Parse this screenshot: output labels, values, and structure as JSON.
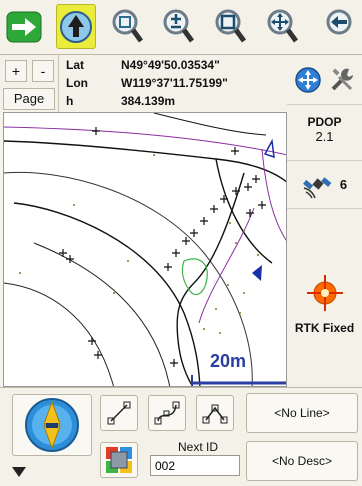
{
  "toolbar": {
    "buttons": [
      {
        "name": "forward-arrow-icon"
      },
      {
        "name": "north-up-icon"
      },
      {
        "name": "zoom-extents-icon"
      },
      {
        "name": "zoom-in-out-icon"
      },
      {
        "name": "zoom-window-icon"
      },
      {
        "name": "pan-icon"
      },
      {
        "name": "back-arrow-icon"
      }
    ]
  },
  "coords": {
    "plus": "+",
    "minus": "-",
    "page": "Page",
    "lat_label": "Lat",
    "lon_label": "Lon",
    "h_label": "h",
    "lat": "N49°49'50.03534\"",
    "lon": "W119°37'11.75199\"",
    "h": "384.139m"
  },
  "status": {
    "pdop_label": "PDOP",
    "pdop_value": "2.1",
    "satellites": "6",
    "rtk": "RTK Fixed"
  },
  "map": {
    "scale": "20m"
  },
  "bottom": {
    "no_line": "<No Line>",
    "no_desc": "<No Desc>",
    "next_id_label": "Next ID",
    "next_id_value": "002"
  },
  "colors": {
    "accent_yellow": "#e9ec3a",
    "toolbar_bg": "#f3f1e8",
    "scale_blue": "#2a3ea3",
    "rtk_orange": "#ff6a00"
  }
}
